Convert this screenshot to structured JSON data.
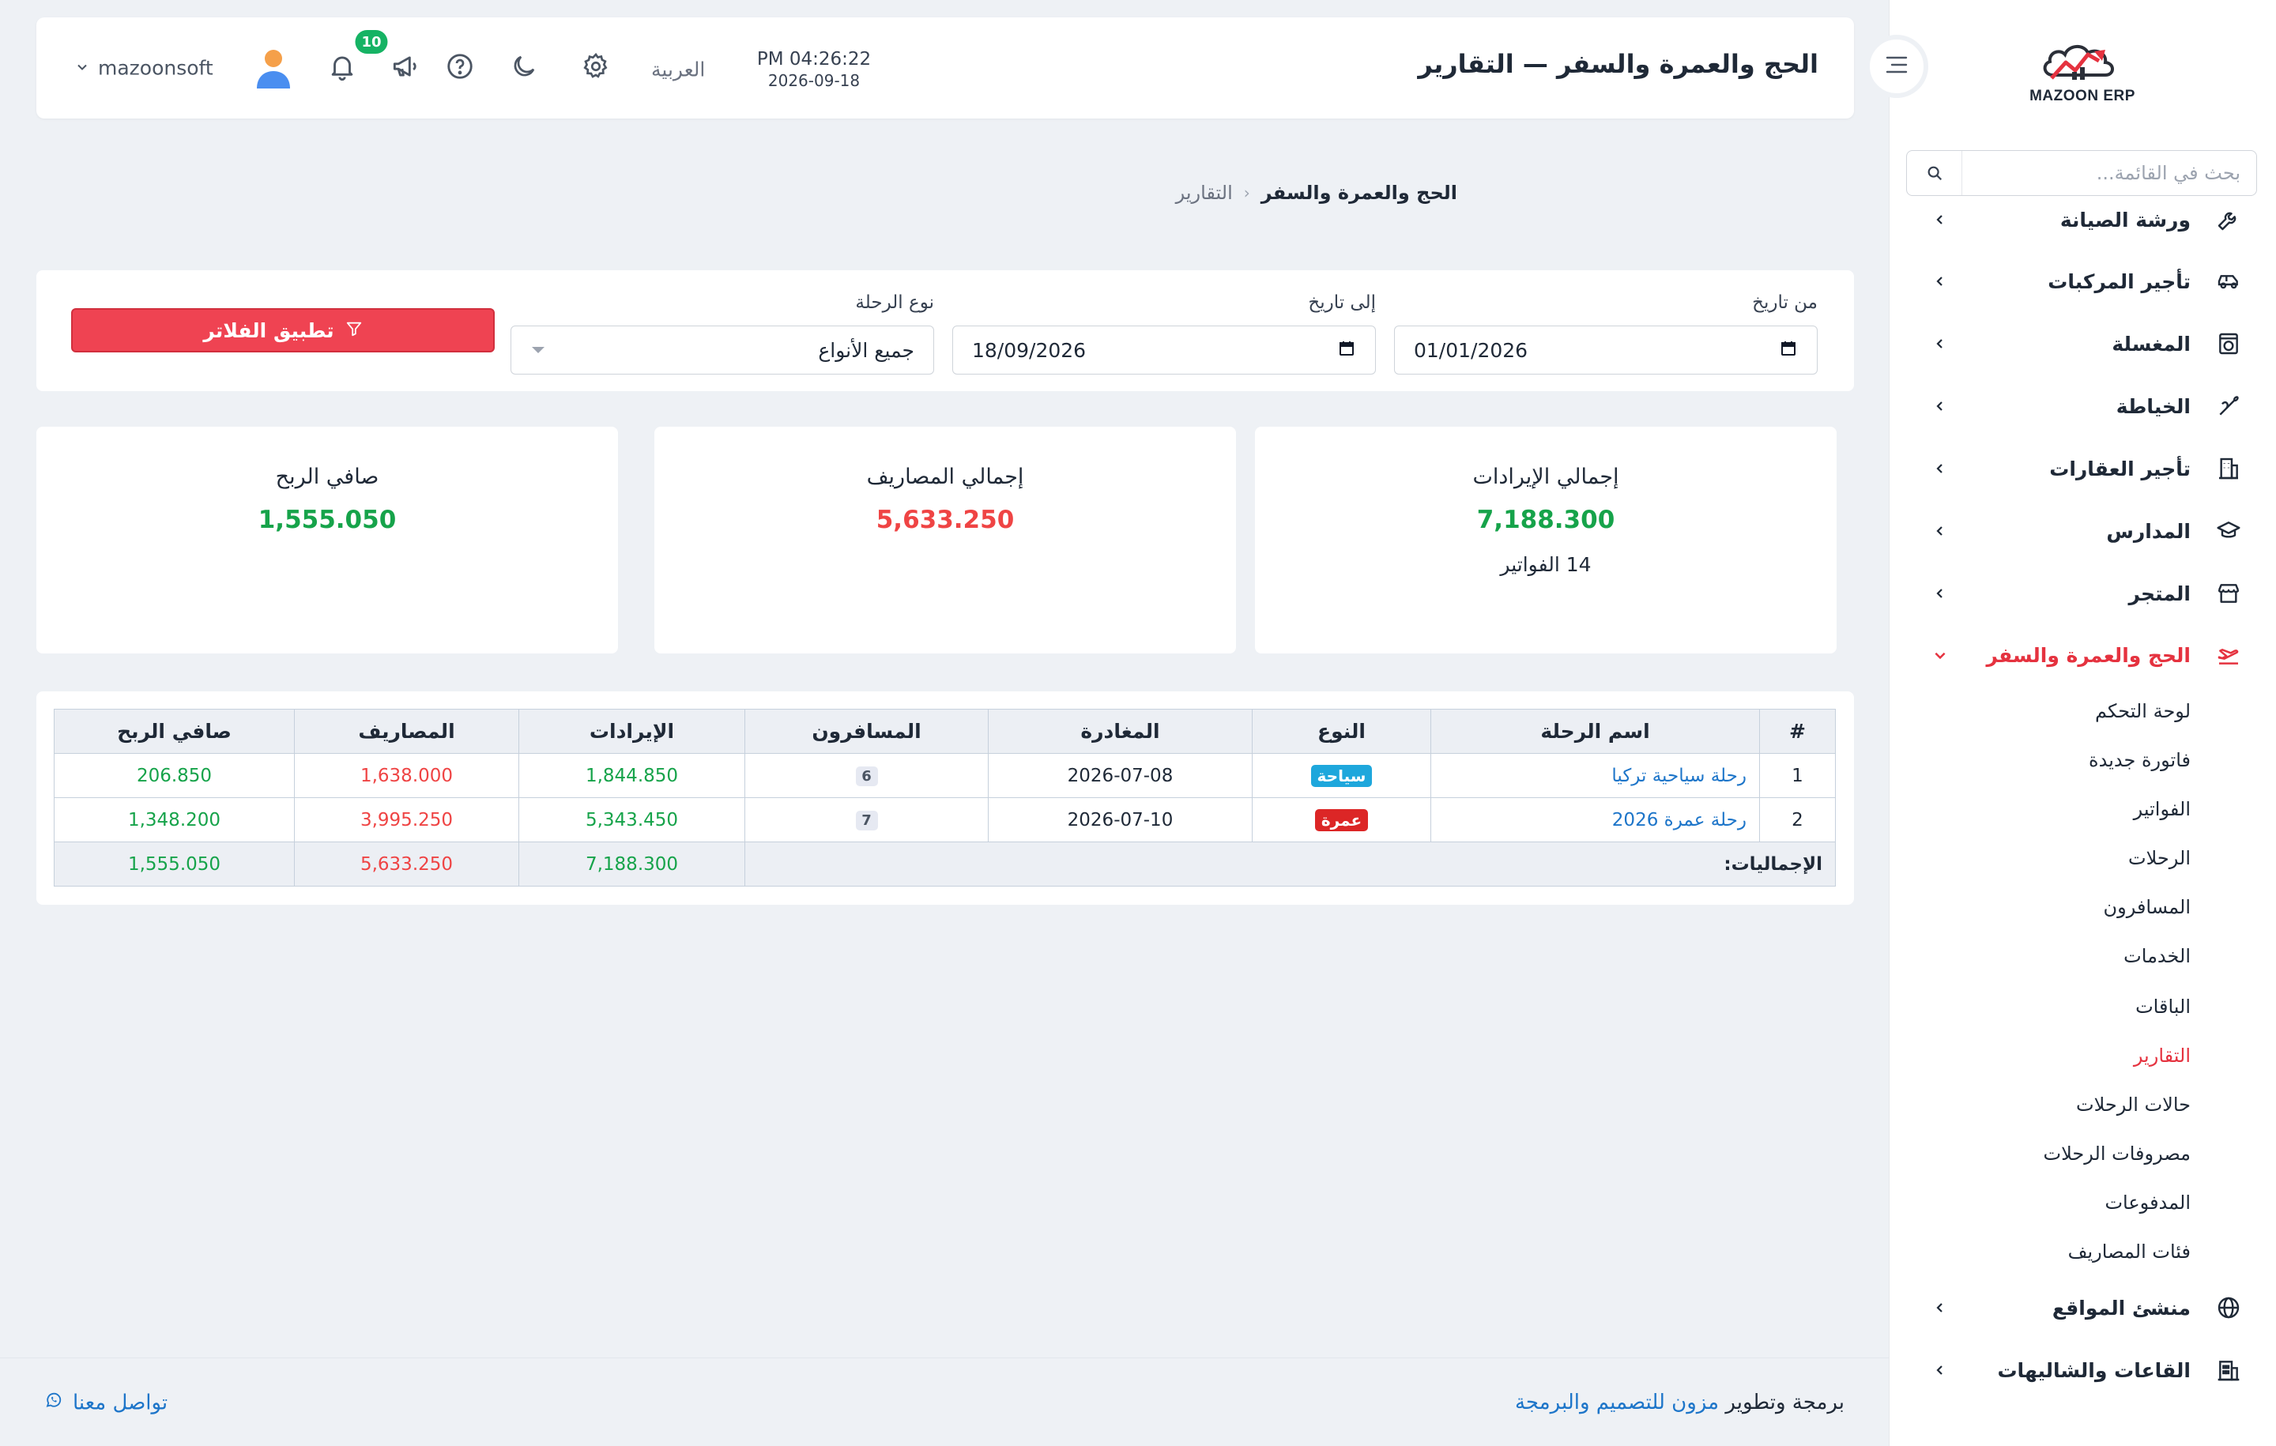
{
  "brand": {
    "logo_text": "MAZOON ERP",
    "logo_subtext": "ERP"
  },
  "sidebar": {
    "search_placeholder": "بحث في القائمة...",
    "items": [
      {
        "label": "ورشة الصيانة",
        "icon": "wrench-icon"
      },
      {
        "label": "تأجير المركبات",
        "icon": "car-icon"
      },
      {
        "label": "المغسلة",
        "icon": "washer-icon"
      },
      {
        "label": "الخياطة",
        "icon": "needle-icon"
      },
      {
        "label": "تأجير العقارات",
        "icon": "building-icon"
      },
      {
        "label": "المدارس",
        "icon": "graduation-cap-icon"
      },
      {
        "label": "المتجر",
        "icon": "store-icon"
      },
      {
        "label": "الحج والعمرة والسفر",
        "icon": "plane-icon",
        "expanded": true
      },
      {
        "label": "منشئ المواقع",
        "icon": "globe-icon"
      },
      {
        "label": "القاعات والشاليهات",
        "icon": "hall-icon"
      }
    ],
    "subitems": [
      {
        "label": "لوحة التحكم"
      },
      {
        "label": "فاتورة جديدة"
      },
      {
        "label": "الفواتير"
      },
      {
        "label": "الرحلات"
      },
      {
        "label": "المسافرون"
      },
      {
        "label": "الخدمات"
      },
      {
        "label": "الباقات"
      },
      {
        "label": "التقارير",
        "active": true
      },
      {
        "label": "حالات الرحلات"
      },
      {
        "label": "مصروفات الرحلات"
      },
      {
        "label": "المدفوعات"
      },
      {
        "label": "فئات المصاريف"
      }
    ]
  },
  "header": {
    "title": "الحج والعمرة والسفر — التقارير",
    "time": "PM 04:26:22",
    "date": "2026-09-18",
    "language": "العربية",
    "notification_count": "10",
    "username": "mazoonsoft"
  },
  "breadcrumb": {
    "parent": "الحج والعمرة والسفر",
    "current": "التقارير"
  },
  "filters": {
    "from_label": "من تاريخ",
    "from_value": "01/01/2026",
    "to_label": "إلى تاريخ",
    "to_value": "18/09/2026",
    "type_label": "نوع الرحلة",
    "type_value": "جميع الأنواع",
    "apply_label": "تطبيق الفلاتر"
  },
  "stats": {
    "revenue_title": "إجمالي الإيرادات",
    "revenue_value": "7,188.300",
    "revenue_sub": "14 الفواتير",
    "expenses_title": "إجمالي المصاريف",
    "expenses_value": "5,633.250",
    "profit_title": "صافي الربح",
    "profit_value": "1,555.050"
  },
  "table": {
    "headers": [
      "#",
      "اسم الرحلة",
      "النوع",
      "المغادرة",
      "المسافرون",
      "الإيرادات",
      "المصاريف",
      "صافي الربح"
    ],
    "rows": [
      {
        "index": "1",
        "name": "رحلة سياحية تركيا",
        "type": "سياحة",
        "type_color": "#1ea7dc",
        "departure": "2026-07-08",
        "travelers": "6",
        "revenue": "1,844.850",
        "expenses": "1,638.000",
        "profit": "206.850"
      },
      {
        "index": "2",
        "name": "رحلة عمرة 2026",
        "type": "عمرة",
        "type_color": "#dc2626",
        "departure": "2026-07-10",
        "travelers": "7",
        "revenue": "5,343.450",
        "expenses": "3,995.250",
        "profit": "1,348.200"
      }
    ],
    "totals": {
      "label": "الإجماليات:",
      "revenue": "7,188.300",
      "expenses": "5,633.250",
      "profit": "1,555.050"
    }
  },
  "footer": {
    "credit_prefix": "برمجة وتطوير",
    "credit_link": "مزون للتصميم والبرمجة",
    "contact": "تواصل معنا"
  },
  "colors": {
    "accent": "#ef4352",
    "positive": "#16a34a",
    "negative": "#ef4444",
    "link": "#1d75c9",
    "badge": "#16b364"
  }
}
